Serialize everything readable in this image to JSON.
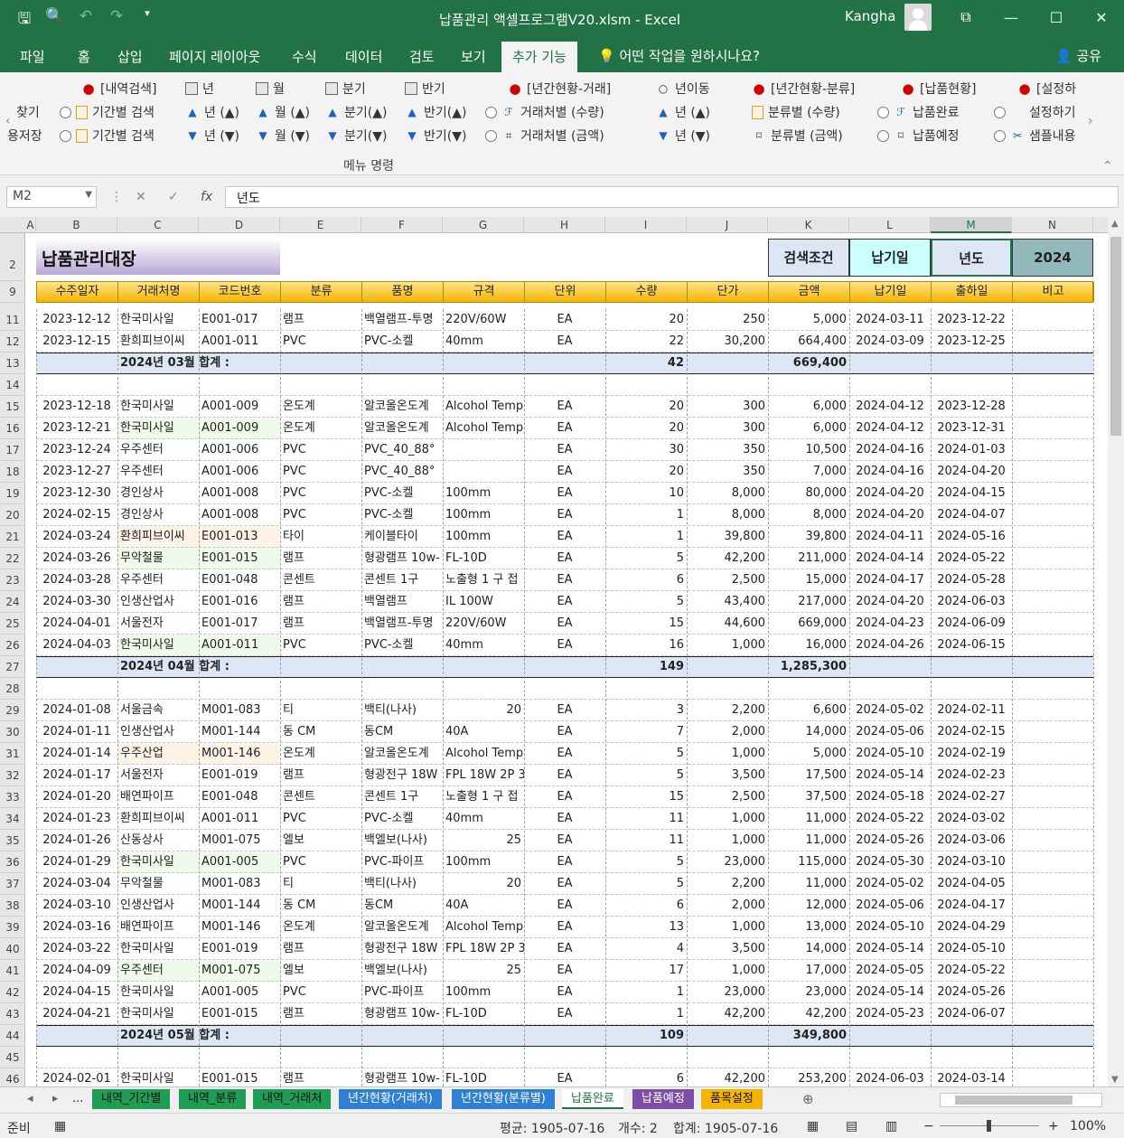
{
  "window": {
    "title": "납품관리 액셀프로그램V20.xlsm  -  Excel",
    "user": "Kangha",
    "min": "—",
    "restore": "☐",
    "close": "✕",
    "ribbon_opts": "⧉"
  },
  "ribbon_tabs": [
    "파일",
    "홈",
    "삽입",
    "페이지 레이아웃",
    "수식",
    "데이터",
    "검토",
    "보기",
    "추가 기능"
  ],
  "tell_me": "어떤 작업을 원하시나요?",
  "share": "공유",
  "ribbon": {
    "row1": [
      "[내역검색]",
      "년",
      "월",
      "분기",
      "반기",
      "[년간현황-거래]",
      "년이동",
      "[년간현황-분류]",
      "[납품현황]",
      "[설정하"
    ],
    "row2": [
      "찾기",
      "기간별 검색",
      "년 (▲)",
      "월 (▲)",
      "분기(▲)",
      "반기(▲)",
      "거래처별 (수량)",
      "년 (▲)",
      "분류별 (수량)",
      "납품완료",
      "설정하기"
    ],
    "row3": [
      "용저장",
      "기간별 검색",
      "년 (▼)",
      "월 (▼)",
      "분기(▼)",
      "반기(▼)",
      "거래처별 (금액)",
      "년 (▼)",
      "분류별 (금액)",
      "납품예정",
      "샘플내용"
    ],
    "group_label": "메뉴 명령"
  },
  "formula_bar": {
    "name_box": "M2",
    "formula": "년도",
    "fx": "fx"
  },
  "columns": [
    "A",
    "B",
    "C",
    "D",
    "E",
    "F",
    "G",
    "H",
    "I",
    "J",
    "K",
    "L",
    "M",
    "N"
  ],
  "row_numbers": [
    "2",
    "9",
    "11",
    "12",
    "13",
    "14",
    "15",
    "16",
    "17",
    "18",
    "19",
    "20",
    "21",
    "22",
    "23",
    "24",
    "25",
    "26",
    "27",
    "28",
    "29",
    "30",
    "31",
    "32",
    "33",
    "34",
    "35",
    "36",
    "37",
    "38",
    "39",
    "40",
    "41",
    "42",
    "43",
    "44",
    "45",
    "46"
  ],
  "sheet_title": "납품관리대장",
  "search": {
    "label": "검색조건",
    "field": "납기일",
    "year_label": "년도",
    "year": "2024"
  },
  "headers": [
    "수주일자",
    "거래처명",
    "코드번호",
    "분류",
    "품명",
    "규격",
    "단위",
    "수량",
    "단가",
    "금액",
    "납기일",
    "출하일",
    "비고"
  ],
  "rows": [
    [
      "2023-12-12",
      "한국미사일",
      "E001-017",
      "램프",
      "백열램프-투명",
      "220V/60W",
      "EA",
      "20",
      "250",
      "5,000",
      "2024-03-11",
      "2023-12-22",
      ""
    ],
    [
      "2023-12-15",
      "환희피브이씨",
      "A001-011",
      "PVC",
      "PVC-소켈",
      "40mm",
      "EA",
      "22",
      "30,200",
      "664,400",
      "2024-03-09",
      "2023-12-25",
      ""
    ],
    {
      "sub": "2024년 03월 합계 :",
      "qty": "42",
      "amt": "669,400"
    },
    null,
    [
      "2023-12-18",
      "한국미사일",
      "A001-009",
      "온도계",
      "알코올온도계",
      "Alcohol Temp",
      "EA",
      "20",
      "300",
      "6,000",
      "2024-04-12",
      "2023-12-28",
      ""
    ],
    [
      "2023-12-21",
      "한국미사일",
      "A001-009",
      "온도계",
      "알코올온도계",
      "Alcohol Temp",
      "EA",
      "20",
      "300",
      "6,000",
      "2024-04-12",
      "2023-12-31",
      ""
    ],
    [
      "2023-12-24",
      "우주센터",
      "A001-006",
      "PVC",
      "PVC_40_88°",
      "",
      "EA",
      "30",
      "350",
      "10,500",
      "2024-04-16",
      "2024-01-03",
      ""
    ],
    [
      "2023-12-27",
      "우주센터",
      "A001-006",
      "PVC",
      "PVC_40_88°",
      "",
      "EA",
      "20",
      "350",
      "7,000",
      "2024-04-16",
      "2024-04-20",
      ""
    ],
    [
      "2023-12-30",
      "경인상사",
      "A001-008",
      "PVC",
      "PVC-소켈",
      "100mm",
      "EA",
      "10",
      "8,000",
      "80,000",
      "2024-04-20",
      "2024-04-15",
      ""
    ],
    [
      "2024-02-15",
      "경인상사",
      "A001-008",
      "PVC",
      "PVC-소켈",
      "100mm",
      "EA",
      "1",
      "8,000",
      "8,000",
      "2024-04-20",
      "2024-04-07",
      ""
    ],
    [
      "2024-03-24",
      "환희피브이씨",
      "E001-013",
      "타이",
      "케이블타이",
      "100mm",
      "EA",
      "1",
      "39,800",
      "39,800",
      "2024-04-11",
      "2024-05-16",
      ""
    ],
    [
      "2024-03-26",
      "무악철물",
      "E001-015",
      "램프",
      "형광램프 10w-",
      "FL-10D",
      "EA",
      "5",
      "42,200",
      "211,000",
      "2024-04-14",
      "2024-05-22",
      ""
    ],
    [
      "2024-03-28",
      "우주센터",
      "E001-048",
      "콘센트",
      "콘센트 1구",
      "노출형 1 구 접",
      "EA",
      "6",
      "2,500",
      "15,000",
      "2024-04-17",
      "2024-05-28",
      ""
    ],
    [
      "2024-03-30",
      "인생산업사",
      "E001-016",
      "램프",
      "백열램프",
      "IL 100W",
      "EA",
      "5",
      "43,400",
      "217,000",
      "2024-04-20",
      "2024-06-03",
      ""
    ],
    [
      "2024-04-01",
      "서울전자",
      "E001-017",
      "램프",
      "백열램프-투명",
      "220V/60W",
      "EA",
      "15",
      "44,600",
      "669,000",
      "2024-04-23",
      "2024-06-09",
      ""
    ],
    [
      "2024-04-03",
      "한국미사일",
      "A001-011",
      "PVC",
      "PVC-소켈",
      "40mm",
      "EA",
      "16",
      "1,000",
      "16,000",
      "2024-04-26",
      "2024-06-15",
      ""
    ],
    {
      "sub": "2024년 04월 합계 :",
      "qty": "149",
      "amt": "1,285,300"
    },
    null,
    [
      "2024-01-08",
      "서울금속",
      "M001-083",
      "티",
      "백티(나사)",
      "20",
      "EA",
      "3",
      "2,200",
      "6,600",
      "2024-05-02",
      "2024-02-11",
      ""
    ],
    [
      "2024-01-11",
      "인생산업사",
      "M001-144",
      "동 CM",
      "동CM",
      "40A",
      "EA",
      "7",
      "2,000",
      "14,000",
      "2024-05-06",
      "2024-02-15",
      ""
    ],
    [
      "2024-01-14",
      "우주산업",
      "M001-146",
      "온도계",
      "알코올온도계",
      "Alcohol Temp",
      "EA",
      "5",
      "1,000",
      "5,000",
      "2024-05-10",
      "2024-02-19",
      ""
    ],
    [
      "2024-01-17",
      "서울전자",
      "E001-019",
      "램프",
      "형광전구 18W",
      "FPL 18W 2P 3파",
      "EA",
      "5",
      "3,500",
      "17,500",
      "2024-05-14",
      "2024-02-23",
      ""
    ],
    [
      "2024-01-20",
      "배연파이프",
      "E001-048",
      "콘센트",
      "콘센트 1구",
      "노출형 1 구 접",
      "EA",
      "15",
      "2,500",
      "37,500",
      "2024-05-18",
      "2024-02-27",
      ""
    ],
    [
      "2024-01-23",
      "환희피브이씨",
      "A001-011",
      "PVC",
      "PVC-소켈",
      "40mm",
      "EA",
      "11",
      "1,000",
      "11,000",
      "2024-05-22",
      "2024-03-02",
      ""
    ],
    [
      "2024-01-26",
      "산동상사",
      "M001-075",
      "엘보",
      "백엘보(나사)",
      "25",
      "EA",
      "11",
      "1,000",
      "11,000",
      "2024-05-26",
      "2024-03-06",
      ""
    ],
    [
      "2024-01-29",
      "한국미사일",
      "A001-005",
      "PVC",
      "PVC-파이프",
      "100mm",
      "EA",
      "5",
      "23,000",
      "115,000",
      "2024-05-30",
      "2024-03-10",
      ""
    ],
    [
      "2024-03-04",
      "무악철물",
      "M001-083",
      "티",
      "백티(나사)",
      "20",
      "EA",
      "5",
      "2,200",
      "11,000",
      "2024-05-02",
      "2024-04-05",
      ""
    ],
    [
      "2024-03-10",
      "인생산업사",
      "M001-144",
      "동 CM",
      "동CM",
      "40A",
      "EA",
      "6",
      "2,000",
      "12,000",
      "2024-05-06",
      "2024-04-17",
      ""
    ],
    [
      "2024-03-16",
      "배연파이프",
      "M001-146",
      "온도계",
      "알코올온도계",
      "Alcohol Temp",
      "EA",
      "13",
      "1,000",
      "13,000",
      "2024-05-10",
      "2024-04-29",
      ""
    ],
    [
      "2024-03-22",
      "한국미사일",
      "E001-019",
      "램프",
      "형광전구 18W",
      "FPL 18W 2P 3파",
      "EA",
      "4",
      "3,500",
      "14,000",
      "2024-05-14",
      "2024-05-10",
      ""
    ],
    [
      "2024-04-09",
      "우주센터",
      "M001-075",
      "엘보",
      "백엘보(나사)",
      "25",
      "EA",
      "17",
      "1,000",
      "17,000",
      "2024-05-05",
      "2024-05-22",
      ""
    ],
    [
      "2024-04-15",
      "한국미사일",
      "A001-005",
      "PVC",
      "PVC-파이프",
      "100mm",
      "EA",
      "1",
      "23,000",
      "23,000",
      "2024-05-14",
      "2024-05-26",
      ""
    ],
    [
      "2024-04-21",
      "한국미사일",
      "E001-015",
      "램프",
      "형광램프 10w-",
      "FL-10D",
      "EA",
      "1",
      "42,200",
      "42,200",
      "2024-05-23",
      "2024-06-07",
      ""
    ],
    {
      "sub": "2024년 05월 합계 :",
      "qty": "109",
      "amt": "349,800"
    },
    null,
    [
      "2024-02-01",
      "한국미사일",
      "E001-015",
      "램프",
      "형광램프 10w-",
      "FL-10D",
      "EA",
      "6",
      "42,200",
      "253,200",
      "2024-06-03",
      "2024-03-14",
      ""
    ]
  ],
  "sheet_tabs": [
    "...",
    "내역_기간별",
    "내역_분류",
    "내역_거래처",
    "년간현황(거래처)",
    "년간현황(분류별)",
    "납품완료",
    "납품예정",
    "품목설정"
  ],
  "status": {
    "ready": "준비",
    "avg": "평균: 1905-07-16",
    "count": "개수: 2",
    "sum": "합계: 1905-07-16",
    "zoom": "100%"
  },
  "colors": {
    "excel_green": "#217346",
    "header_gold": "#f4b400",
    "subtotal_blue": "#dde6f4",
    "title_purple": "#b9a8d7"
  }
}
